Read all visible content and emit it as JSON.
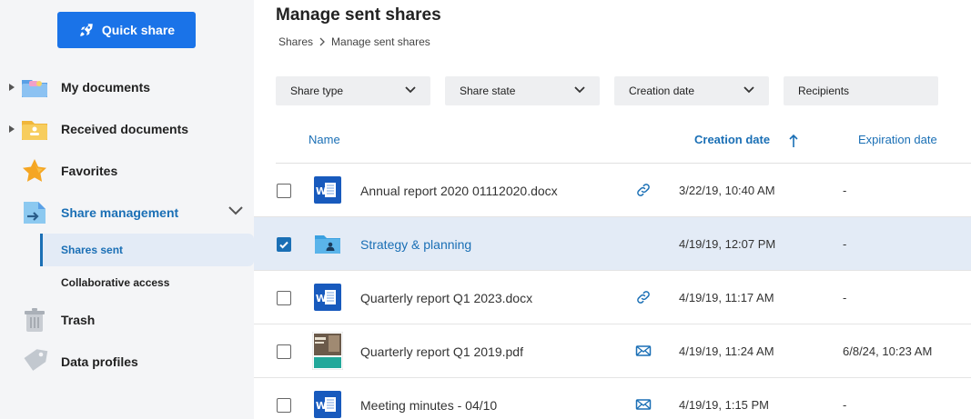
{
  "sidebar": {
    "quick_share_label": "Quick share",
    "items": [
      {
        "label": "My documents",
        "icon": "folder-icon"
      },
      {
        "label": "Received documents",
        "icon": "received-folder-icon"
      },
      {
        "label": "Favorites",
        "icon": "star-icon"
      },
      {
        "label": "Share management",
        "icon": "share-management-icon"
      },
      {
        "label": "Trash",
        "icon": "trash-icon"
      },
      {
        "label": "Data profiles",
        "icon": "tag-icon"
      }
    ],
    "sub_items": [
      {
        "label": "Shares sent"
      },
      {
        "label": "Collaborative access"
      }
    ]
  },
  "header": {
    "title": "Manage sent shares",
    "breadcrumb": [
      "Shares",
      "Manage sent shares"
    ]
  },
  "filters": [
    {
      "label": "Share type"
    },
    {
      "label": "Share state"
    },
    {
      "label": "Creation date"
    },
    {
      "label": "Recipients"
    }
  ],
  "columns": {
    "name": "Name",
    "creation_date": "Creation date",
    "expiration_date": "Expiration date"
  },
  "rows": [
    {
      "name": "Annual report 2020 01112020.docx",
      "type": "word",
      "share": "link-icon",
      "created": "3/22/19, 10:40 AM",
      "expires": "-",
      "checked": false
    },
    {
      "name": "Strategy & planning",
      "type": "folder",
      "share": "",
      "created": "4/19/19, 12:07 PM",
      "expires": "-",
      "checked": true
    },
    {
      "name": "Quarterly report Q1 2023.docx",
      "type": "word",
      "share": "link-icon",
      "created": "4/19/19, 11:17 AM",
      "expires": "-",
      "checked": false
    },
    {
      "name": "Quarterly report Q1 2019.pdf",
      "type": "pdf",
      "share": "mail-icon",
      "created": "4/19/19, 11:24 AM",
      "expires": "6/8/24, 10:23 AM",
      "checked": false
    },
    {
      "name": "Meeting minutes - 04/10",
      "type": "word",
      "share": "mail-icon",
      "created": "4/19/19, 1:15 PM",
      "expires": "-",
      "checked": false
    }
  ],
  "colors": {
    "accent": "#1a73e8",
    "link": "#1a6fb5",
    "selected_row": "#e3ebf6"
  }
}
